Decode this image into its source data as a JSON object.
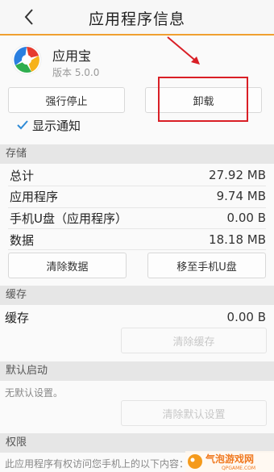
{
  "header": {
    "title": "应用程序信息"
  },
  "app": {
    "name": "应用宝",
    "version": "版本 5.0.0"
  },
  "actions": {
    "force_stop": "强行停止",
    "uninstall": "卸载"
  },
  "notification": {
    "label": "显示通知",
    "checked": true
  },
  "storage": {
    "title": "存储",
    "rows": [
      {
        "label": "总计",
        "value": "27.92 MB"
      },
      {
        "label": "应用程序",
        "value": "9.74 MB"
      },
      {
        "label": "手机U盘（应用程序）",
        "value": "0.00 B"
      },
      {
        "label": "数据",
        "value": "18.18 MB"
      }
    ],
    "clear_data": "清除数据",
    "move_to_usb": "移至手机U盘"
  },
  "cache": {
    "title": "缓存",
    "label": "缓存",
    "value": "0.00 B",
    "clear_cache": "清除缓存"
  },
  "default_launch": {
    "title": "默认启动",
    "hint": "无默认设置。",
    "clear_defaults": "清除默认设置"
  },
  "permissions": {
    "title": "权限",
    "hint": "此应用程序有权访问您手机上的以下内容："
  },
  "watermark": {
    "text": "气泡游戏网",
    "url": "QPGAME.COM"
  },
  "colors": {
    "accent": "#f0a030",
    "annotation": "#d91f26",
    "check": "#2e8bd6"
  }
}
